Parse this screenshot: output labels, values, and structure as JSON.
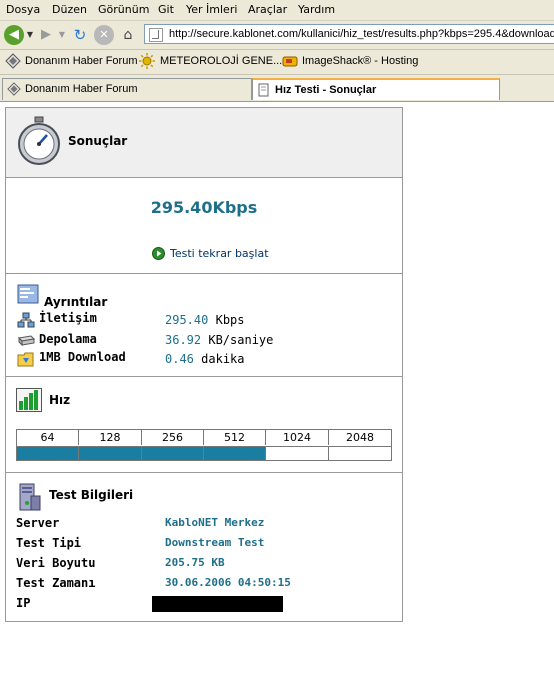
{
  "menu": [
    "Dosya",
    "Düzen",
    "Görünüm",
    "Git",
    "Yer İmleri",
    "Araçlar",
    "Yardım"
  ],
  "url": "http://secure.kablonet.com/kullanici/hiz_test/results.php?kbps=295.4&download",
  "bookmarks": [
    "Donanım Haber Forum",
    "METEOROLOJİ GENE...",
    "ImageShack® - Hosting"
  ],
  "tabs": [
    "Donanım Haber Forum",
    "Hız Testi - Sonuçlar"
  ],
  "results": {
    "title": "Sonuçlar",
    "speed": "295.40Kbps",
    "restart": "Testi tekrar başlat"
  },
  "details": {
    "title": "Ayrıntılar",
    "rows": [
      {
        "label": "İletişim",
        "value": "295.40",
        "unit": "Kbps"
      },
      {
        "label": "Depolama",
        "value": "36.92",
        "unit": "KB/saniye"
      },
      {
        "label": "1MB Download",
        "value": "0.46",
        "unit": "dakika"
      }
    ]
  },
  "speed_chart": {
    "title": "Hız",
    "scale": [
      "64",
      "128",
      "256",
      "512",
      "1024",
      "2048"
    ],
    "filled_segments": 4,
    "bar_color": "#1a7ea0"
  },
  "test_info": {
    "title": "Test Bilgileri",
    "rows": [
      {
        "label": "Server",
        "value": "KabloNET Merkez"
      },
      {
        "label": "Test Tipi",
        "value": "Downstream Test"
      },
      {
        "label": "Veri Boyutu",
        "value": "205.75 KB"
      },
      {
        "label": "Test Zamanı",
        "value": "30.06.2006 04:50:15"
      },
      {
        "label": "IP",
        "value": ""
      }
    ]
  }
}
